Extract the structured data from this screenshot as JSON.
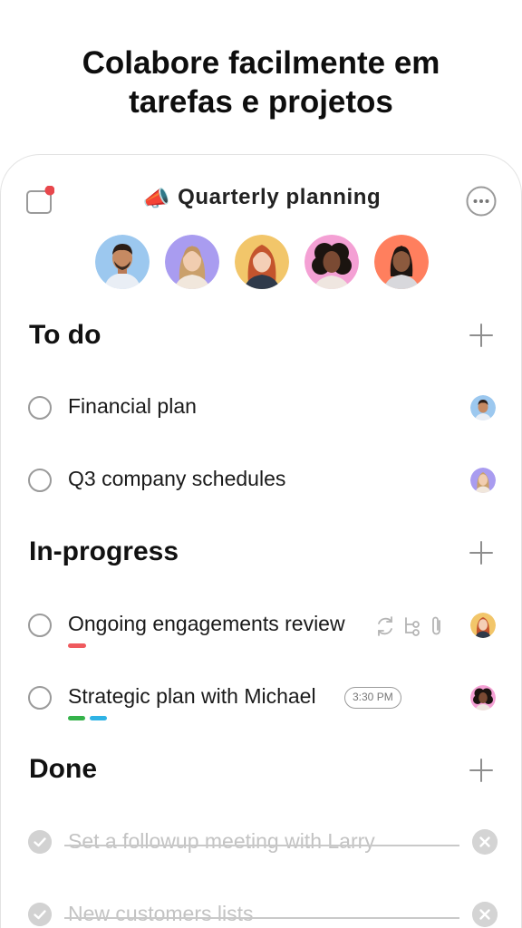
{
  "headline": {
    "line1": "Colabore facilmente em",
    "line2": "tarefas e projetos"
  },
  "project": {
    "emoji": "📣",
    "title": "Quarterly planning",
    "has_notification": true,
    "notification_color": "#e8474c"
  },
  "collaborators": [
    {
      "name": "avatar-1",
      "bg": "#9cc8ef"
    },
    {
      "name": "avatar-2",
      "bg": "#a99cf0"
    },
    {
      "name": "avatar-3",
      "bg": "#f2c66a"
    },
    {
      "name": "avatar-4",
      "bg": "#f4a0d4"
    },
    {
      "name": "avatar-5",
      "bg": "#ff7f5e"
    }
  ],
  "sections": {
    "todo": {
      "title": "To do"
    },
    "in_progress": {
      "title": "In-progress"
    },
    "done": {
      "title": "Done"
    }
  },
  "tasks": {
    "financial_plan": {
      "label": "Financial plan"
    },
    "q3_schedules": {
      "label": "Q3 company schedules"
    },
    "engagements_review": {
      "label": "Ongoing engagements review",
      "tag_color": "#ef5a5e"
    },
    "strategic_plan": {
      "label": "Strategic plan with Michael",
      "time": "3:30 PM",
      "tag_colors": [
        "#34b24a",
        "#2fb3e5"
      ]
    },
    "followup_meeting": {
      "label": "Set a followup meeting with Larry"
    },
    "customers_lists": {
      "label": "New customers lists"
    }
  }
}
